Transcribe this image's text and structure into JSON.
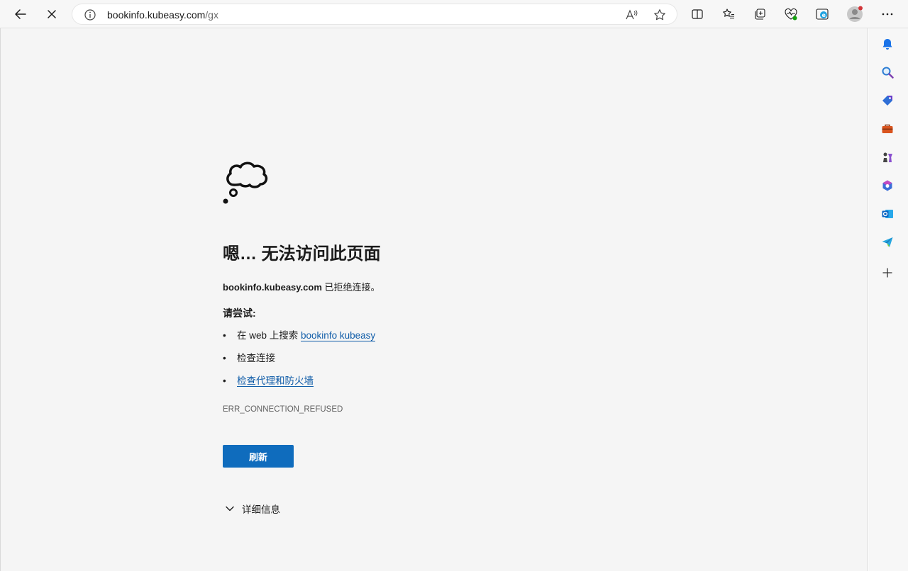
{
  "browser": {
    "url_host": "bookinfo.kubeasy.com",
    "url_path": "/gx",
    "colors": {
      "accent": "#0f6cbd",
      "link": "#0f5ca8",
      "page_bg": "#f5f5f5"
    }
  },
  "error_page": {
    "heading": "嗯… 无法访问此页面",
    "host": "bookinfo.kubeasy.com",
    "message_suffix": " 已拒绝连接。",
    "try_label": "请尝试:",
    "suggestions": {
      "search_prefix": "在 web 上搜索 ",
      "search_link": "bookinfo kubeasy",
      "check_connection": "检查连接",
      "check_proxy": "检查代理和防火墙"
    },
    "error_code": "ERR_CONNECTION_REFUSED",
    "refresh_label": "刷新",
    "details_label": "详细信息"
  }
}
